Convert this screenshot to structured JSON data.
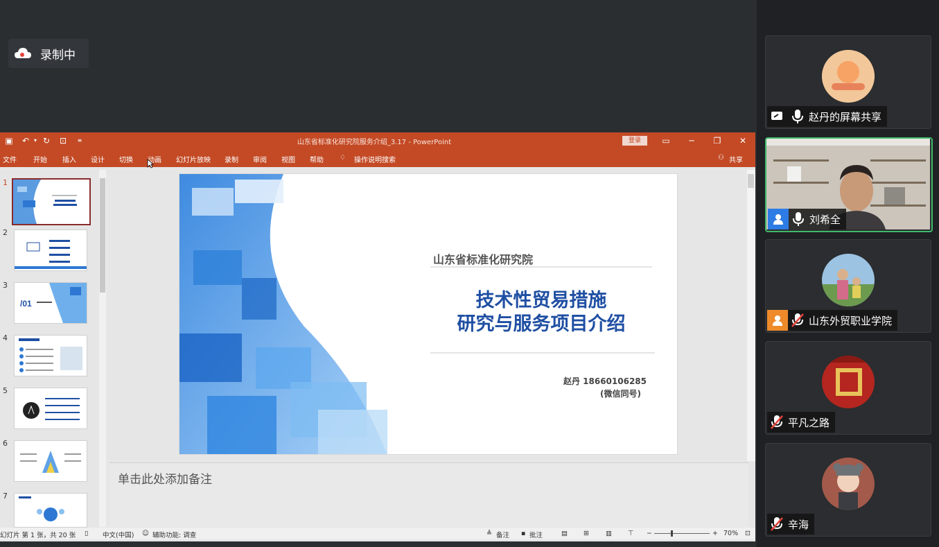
{
  "recording": {
    "label": "录制中",
    "icon": "cloud-icon"
  },
  "ppt": {
    "doc_title": "山东省标准化研究院服务介绍_3.17  -  PowerPoint",
    "login": "登录",
    "menu": [
      "文件",
      "开始",
      "插入",
      "设计",
      "切换",
      "动画",
      "幻灯片放映",
      "录制",
      "审阅",
      "视图",
      "帮助",
      "操作说明搜索"
    ],
    "share": "共享",
    "slide_numbers": [
      "1",
      "2",
      "3",
      "4",
      "5",
      "6",
      "7"
    ],
    "slide": {
      "org": "山东省标准化研究院",
      "title_line1": "技术性贸易措施",
      "title_line2": "研究与服务项目介绍",
      "contact": "赵丹  18660106285",
      "wechat": "(微信同号)"
    },
    "notes_placeholder": "单击此处添加备注",
    "status": {
      "slide_info": "幻灯片 第 1 张，共 20 张",
      "language": "中文(中国)",
      "accessibility": "辅助功能: 调查",
      "notes": "备注",
      "comments": "批注",
      "zoom": "70%"
    },
    "colors": {
      "titlebar": "#c34a25",
      "slide_title": "#1f4fa3"
    }
  },
  "participants": [
    {
      "name": "赵丹的屏幕共享",
      "state": "screen-share",
      "mic": "on"
    },
    {
      "name": "刘希全",
      "state": "video",
      "mic": "on",
      "active": true
    },
    {
      "name": "山东外贸职业学院",
      "state": "avatar",
      "mic": "muted"
    },
    {
      "name": "平凡之路",
      "state": "avatar",
      "mic": "muted"
    },
    {
      "name": "辛海",
      "state": "avatar",
      "mic": "muted"
    }
  ]
}
